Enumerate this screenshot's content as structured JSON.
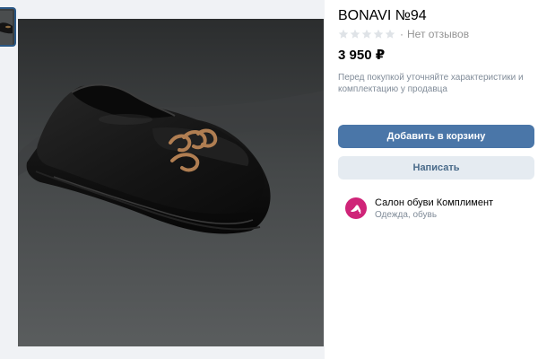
{
  "product": {
    "title": "BONAVI №94",
    "rating_stars": 0,
    "rating_max": 5,
    "reviews_text": "Нет отзывов",
    "price": "3 950 ₽",
    "note": "Перед покупкой уточняйте характеристики и комплектацию у продавца"
  },
  "actions": {
    "add_to_cart_label": "Добавить в корзину",
    "message_label": "Написать"
  },
  "seller": {
    "name": "Салон обуви Комплимент",
    "category": "Одежда, обувь"
  },
  "gallery": {
    "photo": "black-loafer-with-gold-chain-photo",
    "thumbnail": "black-loafer-thumbnail"
  },
  "colors": {
    "primary_button": "#4a76a8",
    "secondary_button": "#e5ebf1",
    "muted_text": "#818c99",
    "seller_avatar": "#cf2478"
  }
}
